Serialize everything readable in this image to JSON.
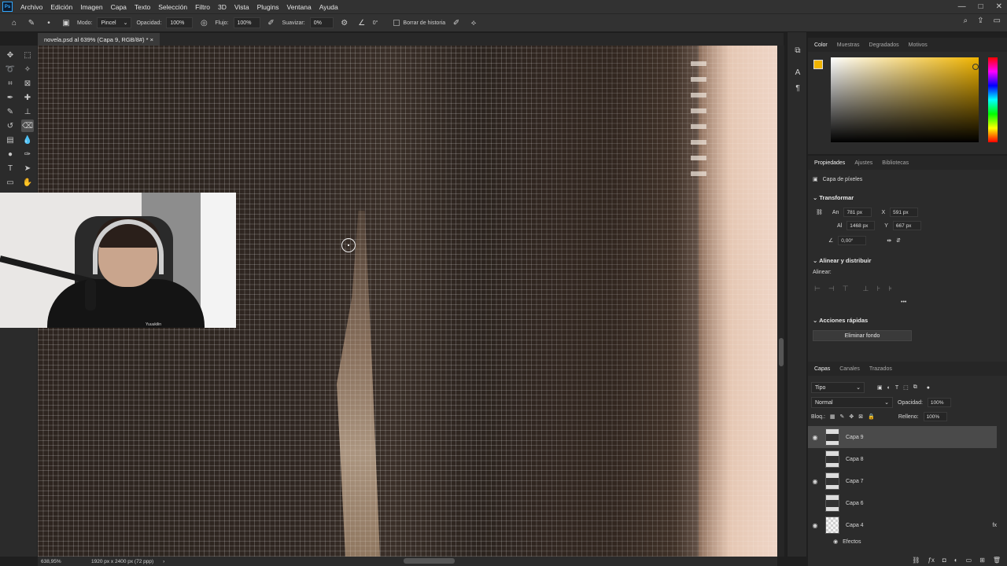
{
  "app": {
    "logo": "Ps"
  },
  "menu": [
    "Archivo",
    "Edición",
    "Imagen",
    "Capa",
    "Texto",
    "Selección",
    "Filtro",
    "3D",
    "Vista",
    "Plugins",
    "Ventana",
    "Ayuda"
  ],
  "options": {
    "mode_label": "Modo:",
    "mode_value": "Pincel",
    "opacity_label": "Opacidad:",
    "opacity_value": "100%",
    "flow_label": "Flujo:",
    "flow_value": "100%",
    "smooth_label": "Suavizar:",
    "smooth_value": "0%",
    "angle_value": "0°",
    "history_label": "Borrar de historia"
  },
  "document": {
    "tab_title": "novela.psd al 639% (Capa 9, RGB/8#) *",
    "close": "×"
  },
  "status": {
    "zoom": "638,95%",
    "info": "1920 px x 2400 px (72 ppp)",
    "arrow": "›"
  },
  "color_panel": {
    "tabs": [
      "Color",
      "Muestras",
      "Degradados",
      "Motivos"
    ],
    "foreground_color": "#f0b400"
  },
  "properties": {
    "tabs": [
      "Propiedades",
      "Ajustes",
      "Bibliotecas"
    ],
    "layer_type": "Capa de píxeles",
    "transform_title": "Transformar",
    "w_label": "An",
    "w_value": "781 px",
    "x_label": "X",
    "x_value": "591 px",
    "h_label": "Al",
    "h_value": "1468 px",
    "y_label": "Y",
    "y_value": "667 px",
    "angle_value": "0,00°",
    "align_title": "Alinear y distribuir",
    "align_label": "Alinear:",
    "quick_title": "Acciones rápidas",
    "remove_bg": "Eliminar fondo"
  },
  "layers": {
    "tabs": [
      "Capas",
      "Canales",
      "Trazados"
    ],
    "filter": "Tipo",
    "blend": "Normal",
    "opacity_label": "Opacidad:",
    "opacity_value": "100%",
    "lock_label": "Bloq.:",
    "fill_label": "Relleno:",
    "fill_value": "100%",
    "items": [
      {
        "name": "Capa 9",
        "visible": true,
        "selected": true
      },
      {
        "name": "Capa 8",
        "visible": false
      },
      {
        "name": "Capa 7",
        "visible": true
      },
      {
        "name": "Capa 6",
        "visible": false
      },
      {
        "name": "Capa 4",
        "visible": true,
        "fx": "fx"
      }
    ],
    "effects_label": "Efectos"
  },
  "webcam": {
    "caption": "Yuuukilin"
  }
}
